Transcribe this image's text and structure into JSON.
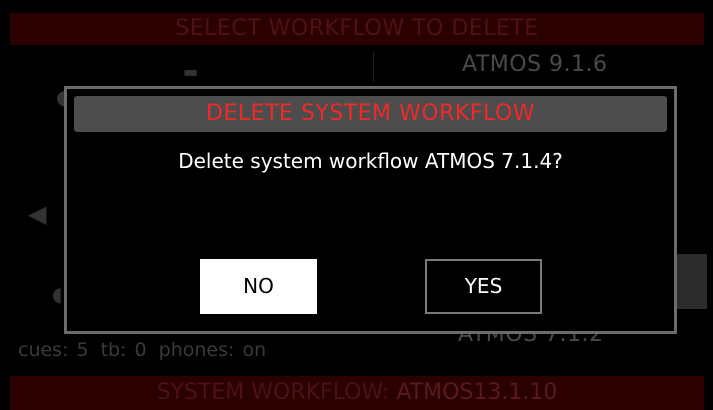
{
  "background": {
    "header_title": "SELECT WORKFLOW TO DELETE",
    "list_item_top": "ATMOS 9.1.6",
    "list_item_bottom": "ATMOS 7.1.2",
    "status": {
      "cues": "cues: 5",
      "tb": "tb: 0",
      "phones": "phones: on"
    },
    "footer_label": "SYSTEM WORKFLOW:",
    "footer_value": "ATMOS13.1.10"
  },
  "dialog": {
    "title": "DELETE SYSTEM WORKFLOW",
    "message": "Delete system workflow ATMOS 7.1.4?",
    "no_label": "NO",
    "yes_label": "YES"
  },
  "colors": {
    "title_red": "#f02929",
    "header_bar": "#2a0000",
    "titlebar_gray": "#4d4d4d",
    "dialog_border": "#6b6b6b"
  }
}
